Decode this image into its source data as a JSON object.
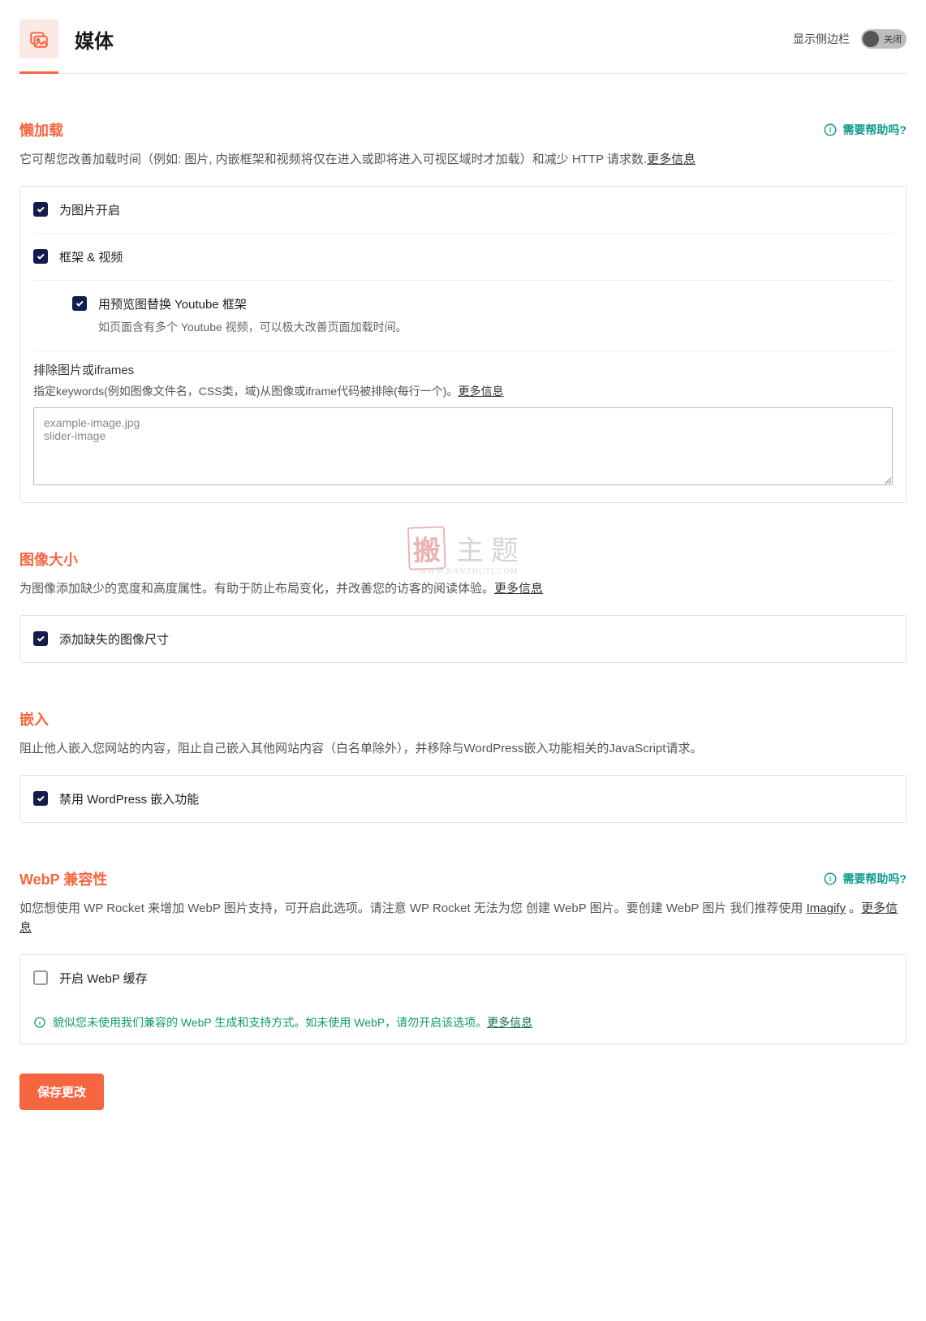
{
  "header": {
    "title": "媒体",
    "sidebar_label": "显示侧边栏",
    "toggle_off": "关闭"
  },
  "help_label": "需要帮助吗?",
  "sections": {
    "lazyload": {
      "title": "懒加载",
      "desc_prefix": "它可帮您改善加载时间（例如: 图片, 内嵌框架和视频将仅在进入或即将进入可视区域时才加载）和减少 HTTP 请求数.",
      "more": "更多信息",
      "opt_images": "为图片开启",
      "opt_frames": "框架 & 视频",
      "opt_youtube": "用预览图替换 Youtube 框架",
      "opt_youtube_sub": "如页面含有多个 Youtube 视频，可以极大改善页面加载时间。",
      "exclude_title": "排除图片或iframes",
      "exclude_desc": "指定keywords(例如图像文件名，CSS类，域)从图像或iframe代码被排除(每行一个)。",
      "exclude_more": "更多信息",
      "textarea_placeholder": "example-image.jpg\nslider-image"
    },
    "image_size": {
      "title": "图像大小",
      "desc_prefix": "为图像添加缺少的宽度和高度属性。有助于防止布局变化，并改善您的访客的阅读体验。",
      "more": "更多信息",
      "opt_add": "添加缺失的图像尺寸"
    },
    "embed": {
      "title": "嵌入",
      "desc": "阻止他人嵌入您网站的内容，阻止自己嵌入其他网站内容（白名单除外），并移除与WordPress嵌入功能相关的JavaScript请求。",
      "opt_disable": "禁用 WordPress 嵌入功能"
    },
    "webp": {
      "title": "WebP 兼容性",
      "desc_prefix": "如您想使用 WP Rocket 来增加 WebP 图片支持，可开启此选项。请注意 WP Rocket 无法为您 创建 WebP 图片。要创建 WebP 图片 我们推荐使用 ",
      "imagify": "Imagify",
      "desc_suffix": " 。",
      "more": "更多信息",
      "opt_enable": "开启 WebP 缓存",
      "notice_text": "貌似您未使用我们兼容的 WebP 生成和支持方式。如未使用 WebP，请勿开启该选项。",
      "notice_more": "更多信息"
    }
  },
  "watermark": {
    "stamp": "搬",
    "text": "主 题",
    "sub": "WWW.BANZHUTI.COM"
  },
  "save_button": "保存更改"
}
